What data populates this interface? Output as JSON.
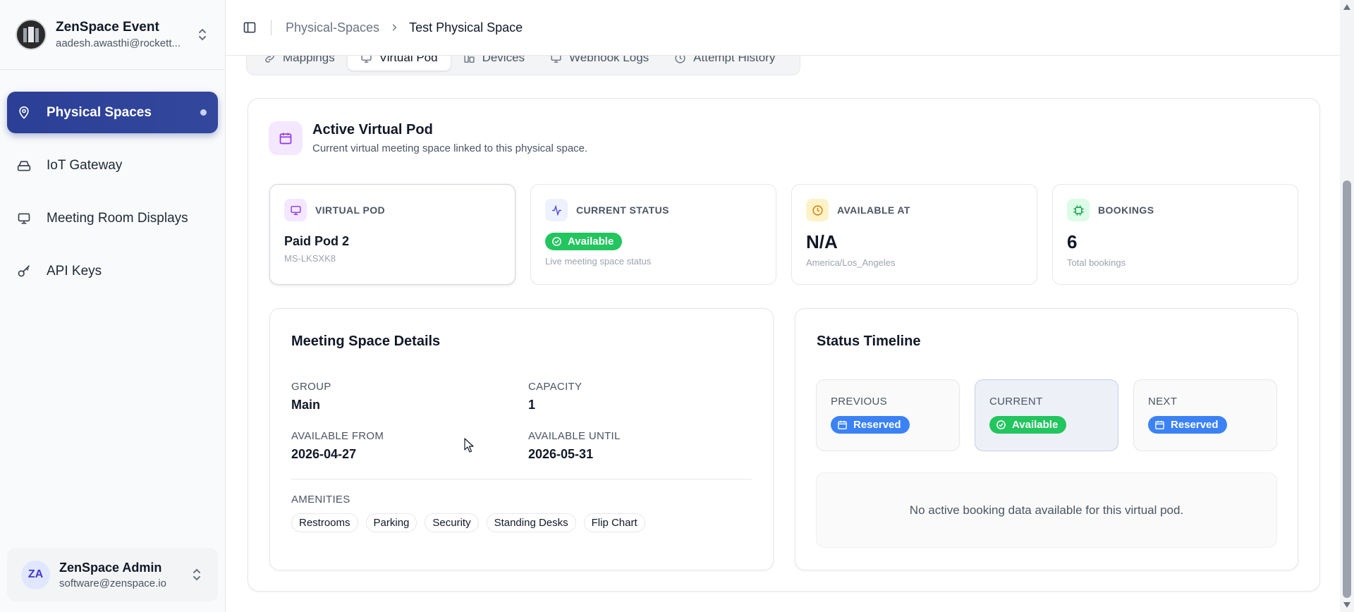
{
  "org": {
    "name": "ZenSpace Event",
    "email": "aadesh.awasthi@rockett..."
  },
  "nav": {
    "items": [
      {
        "label": "Physical Spaces",
        "icon": "map-pin-icon",
        "active": true
      },
      {
        "label": "IoT Gateway",
        "icon": "router-icon"
      },
      {
        "label": "Meeting Room Displays",
        "icon": "monitor-icon"
      },
      {
        "label": "API Keys",
        "icon": "key-icon"
      }
    ]
  },
  "user": {
    "initials": "ZA",
    "name": "ZenSpace Admin",
    "email": "software@zenspace.io"
  },
  "breadcrumb": {
    "parent": "Physical-Spaces",
    "current": "Test Physical Space"
  },
  "tabs": [
    {
      "label": "Mappings",
      "icon": "link-icon"
    },
    {
      "label": "Virtual Pod",
      "icon": "monitor-icon",
      "active": true
    },
    {
      "label": "Devices",
      "icon": "devices-icon"
    },
    {
      "label": "Webhook Logs",
      "icon": "monitor-icon"
    },
    {
      "label": "Attempt History",
      "icon": "clock-icon"
    }
  ],
  "section": {
    "title": "Active Virtual Pod",
    "subtitle": "Current virtual meeting space linked to this physical space."
  },
  "stats": {
    "virtual_pod": {
      "label": "VIRTUAL POD",
      "value": "Paid Pod 2",
      "sub": "MS-LKSXK8"
    },
    "current_status": {
      "label": "CURRENT STATUS",
      "value": "Available",
      "sub": "Live meeting space status"
    },
    "available_at": {
      "label": "AVAILABLE AT",
      "value": "N/A",
      "sub": "America/Los_Angeles"
    },
    "bookings": {
      "label": "BOOKINGS",
      "value": "6",
      "sub": "Total bookings"
    }
  },
  "details": {
    "title": "Meeting Space Details",
    "group_label": "GROUP",
    "group_value": "Main",
    "capacity_label": "CAPACITY",
    "capacity_value": "1",
    "from_label": "AVAILABLE FROM",
    "from_value": "2026-04-27",
    "until_label": "AVAILABLE UNTIL",
    "until_value": "2026-05-31",
    "amenities_label": "AMENITIES",
    "amenities": [
      "Restrooms",
      "Parking",
      "Security",
      "Standing Desks",
      "Flip Chart"
    ]
  },
  "timeline": {
    "title": "Status Timeline",
    "previous_label": "PREVIOUS",
    "previous_status": "Reserved",
    "current_label": "CURRENT",
    "current_status": "Available",
    "next_label": "NEXT",
    "next_status": "Reserved",
    "empty_text": "No active booking data available for this virtual pod."
  },
  "colors": {
    "accent": "#2a3f95",
    "available": "#22c55e",
    "reserved": "#3b82f6"
  }
}
